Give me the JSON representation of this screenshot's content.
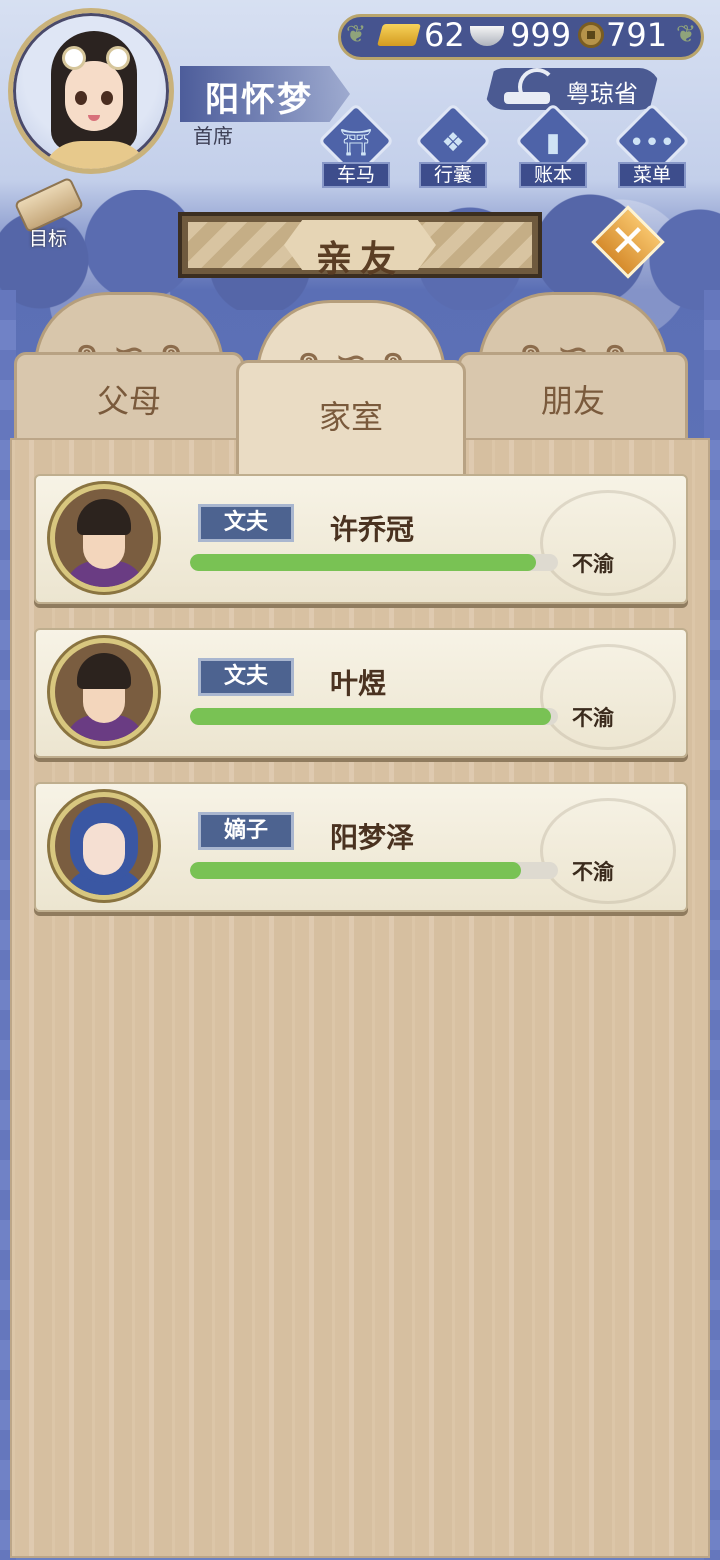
{
  "player": {
    "name": "阳怀梦",
    "rank": "首席"
  },
  "currency": {
    "gold": "62",
    "silver": "999",
    "copper": "791"
  },
  "location": "粤琼省",
  "nav": [
    {
      "label": "车马",
      "icon": "carriage-icon"
    },
    {
      "label": "行囊",
      "icon": "bag-icon"
    },
    {
      "label": "账本",
      "icon": "ledger-icon"
    },
    {
      "label": "菜单",
      "icon": "menu-dots-icon"
    }
  ],
  "goal_label": "目标",
  "panel_title": "亲友",
  "tabs": [
    {
      "label": "父母",
      "active": false
    },
    {
      "label": "家室",
      "active": true
    },
    {
      "label": "朋友",
      "active": false
    }
  ],
  "members": [
    {
      "relation": "文夫",
      "name": "许乔冠",
      "mood": "不渝",
      "mood_level": 0.94
    },
    {
      "relation": "文夫",
      "name": "叶煜",
      "mood": "不渝",
      "mood_level": 0.98
    },
    {
      "relation": "嫡子",
      "name": "阳梦泽",
      "mood": "不渝",
      "mood_level": 0.9
    }
  ],
  "colors": {
    "mood_bar": "#79c254",
    "relation_badge": "#4d6390",
    "accent_gold": "#d68c2d"
  }
}
